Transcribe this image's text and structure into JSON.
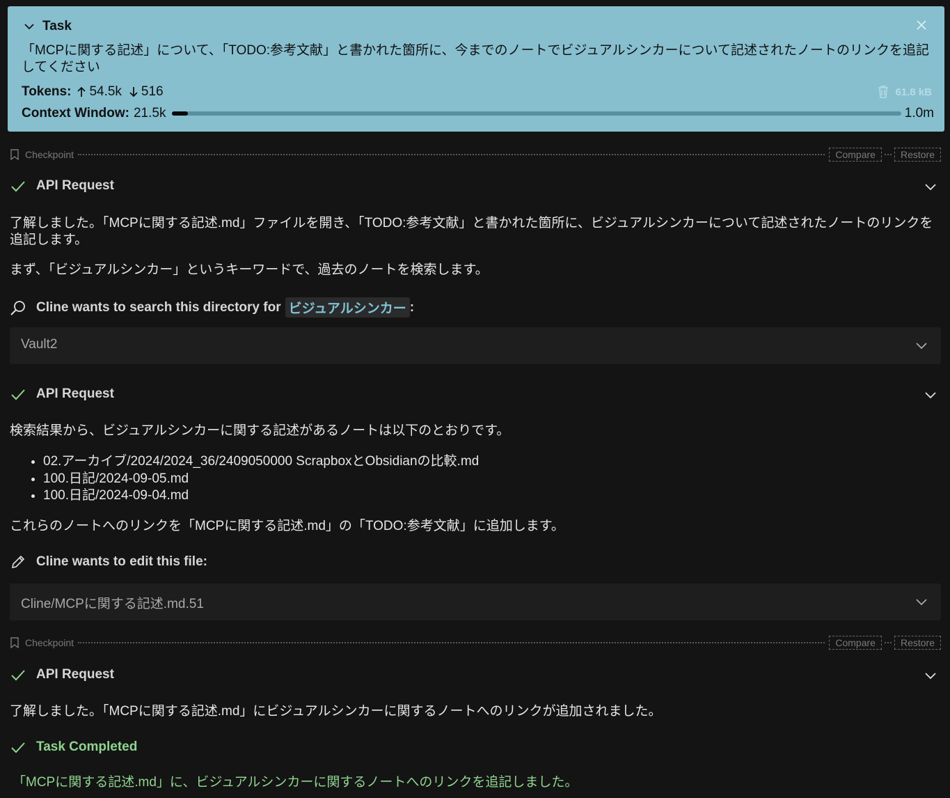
{
  "task": {
    "title": "Task",
    "text": "「MCPに関する記述」について、「TODO:参考文献」と書かれた箇所に、今までのノートでビジュアルシンカーについて記述されたノートのリンクを追記してください",
    "tokens_label": "Tokens:",
    "tokens_up": "54.5k",
    "tokens_down": "516",
    "size": "61.8 kB",
    "context_label": "Context Window:",
    "context_used": "21.5k",
    "context_max": "1.0m",
    "context_fraction": 0.0215
  },
  "checkpoint": {
    "label": "Checkpoint",
    "compare": "Compare",
    "restore": "Restore"
  },
  "blocks": {
    "api1": "API Request",
    "msg1": "了解しました。「MCPに関する記述.md」ファイルを開き、「TODO:参考文献」と書かれた箇所に、ビジュアルシンカーについて記述されたノートのリンクを追記します。",
    "msg2": "まず、「ビジュアルシンカー」というキーワードで、過去のノートを検索します。",
    "search_label": "Cline wants to search this directory for",
    "search_term": "ビジュアルシンカー",
    "search_colon": ":",
    "search_dir": "Vault2",
    "api2": "API Request",
    "msg3": "検索結果から、ビジュアルシンカーに関する記述があるノートは以下のとおりです。",
    "results": [
      "02.アーカイブ/2024/2024_36/2409050000 ScrapboxとObsidianの比較.md",
      "100.日記/2024-09-05.md",
      "100.日記/2024-09-04.md"
    ],
    "msg4": "これらのノートへのリンクを「MCPに関する記述.md」の「TODO:参考文献」に追加します。",
    "edit_label": "Cline wants to edit this file:",
    "edit_file": "Cline/MCPに関する記述.md.51",
    "api3": "API Request",
    "msg5": "了解しました。「MCPに関する記述.md」にビジュアルシンカーに関するノートへのリンクが追加されました。",
    "completed": "Task Completed",
    "completed_msg": "「MCPに関する記述.md」に、ビジュアルシンカーに関するノートへのリンクを追記しました。"
  },
  "colors": {
    "task_bg": "#87bfcf",
    "check": "#8fd48f",
    "page_bg": "#141414"
  }
}
